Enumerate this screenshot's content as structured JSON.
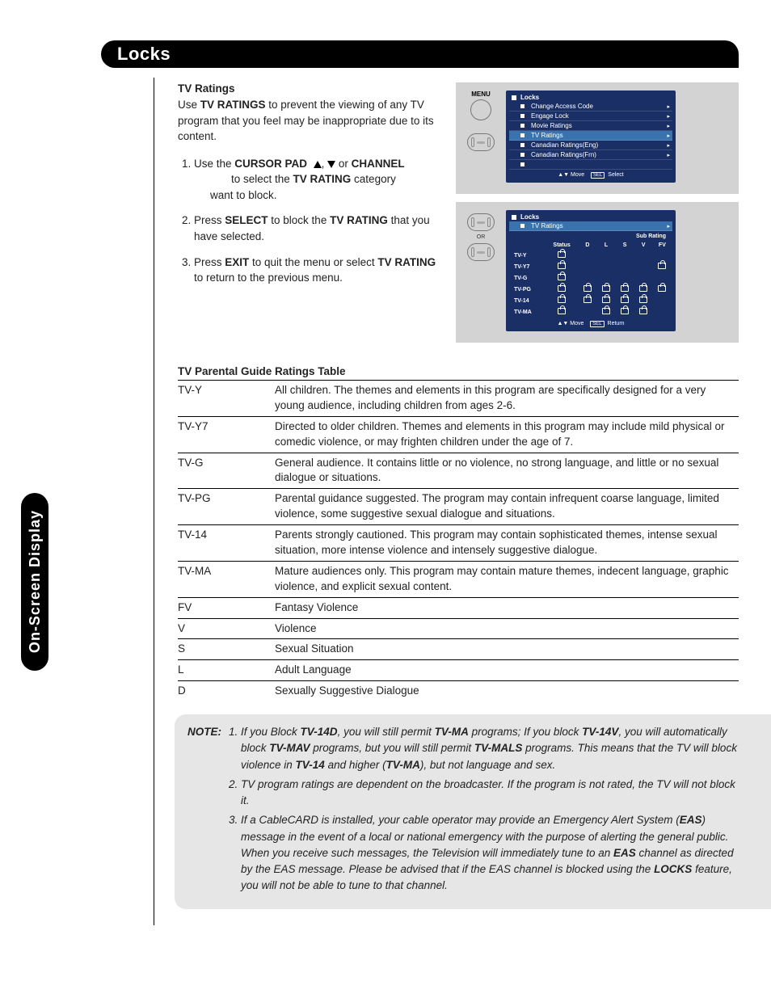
{
  "side_tab": "On-Screen Display",
  "header": "Locks",
  "sec1_title": "TV Ratings",
  "sec1_intro_a": "Use ",
  "sec1_intro_b": "TV RATINGS",
  "sec1_intro_c": " to prevent the viewing of any TV program that you feel may be inappropriate due to its content.",
  "step1_a": "Use the ",
  "step1_b": "CURSOR PAD",
  "step1_c": ", ",
  "step1_d": " or ",
  "step1_e": "CHANNEL",
  "step1_line2_a": " to select the ",
  "step1_line2_b": "TV RATING",
  "step1_line2_c": " category",
  "step1_line3": "want to block.",
  "step2_a": "Press ",
  "step2_b": "SELECT",
  "step2_c": " to block the ",
  "step2_d": "TV RATING",
  "step2_e": " that you have selected.",
  "step3_a": "Press ",
  "step3_b": "EXIT",
  "step3_c": " to quit the menu or select ",
  "step3_d": "TV RATING",
  "step3_e": " to return to the previous menu.",
  "panel1": {
    "menu_label": "MENU",
    "title": "Locks",
    "items": [
      "Change Access Code",
      "Engage Lock",
      "Movie Ratings",
      "TV Ratings",
      "Canadian Ratings(Eng)",
      "Canadian Ratings(Frn)"
    ],
    "foot_move": "Move",
    "foot_sel": "SEL",
    "foot_select": "Select"
  },
  "panel2": {
    "or": "OR",
    "title": "Locks",
    "sub": "TV Ratings",
    "subrating": "Sub Rating",
    "status": "Status",
    "cols": [
      "D",
      "L",
      "S",
      "V",
      "FV"
    ],
    "rows": [
      "TV-Y",
      "TV-Y7",
      "TV-G",
      "TV-PG",
      "TV-14",
      "TV-MA"
    ],
    "foot_move": "Move",
    "foot_sel": "SEL",
    "foot_return": "Return"
  },
  "table_title": "TV Parental Guide Ratings Table",
  "ratings": [
    {
      "code": "TV-Y",
      "desc": "All children. The themes and elements in this program are specifically designed for a very young audience, including children from ages 2-6."
    },
    {
      "code": "TV-Y7",
      "desc": "Directed to older children. Themes and elements in this program may include mild physical or comedic violence, or may frighten children under the age of 7."
    },
    {
      "code": "TV-G",
      "desc": "General audience. It contains little or no violence, no strong language, and little or no sexual dialogue or situations."
    },
    {
      "code": "TV-PG",
      "desc": "Parental guidance suggested. The program may contain infrequent coarse language, limited violence, some suggestive sexual dialogue and situations."
    },
    {
      "code": "TV-14",
      "desc": "Parents strongly cautioned. This program may contain sophisticated themes, intense sexual situation, more intense violence and intensely suggestive dialogue."
    },
    {
      "code": "TV-MA",
      "desc": "Mature audiences only. This program may contain mature themes, indecent language, graphic violence, and explicit sexual content."
    },
    {
      "code": "FV",
      "desc": "Fantasy Violence"
    },
    {
      "code": "V",
      "desc": "Violence"
    },
    {
      "code": "S",
      "desc": "Sexual Situation"
    },
    {
      "code": "L",
      "desc": "Adult Language"
    },
    {
      "code": "D",
      "desc": "Sexually Suggestive Dialogue"
    }
  ],
  "note_label": "NOTE:",
  "notes": {
    "n1": {
      "a": "If you Block ",
      "b": "TV-14D",
      "c": ", you will still permit ",
      "d": "TV-MA",
      "e": " programs; If you block ",
      "f": "TV-14V",
      "g": ", you will automatically block ",
      "h": "TV-MAV",
      "i": " programs, but you will still permit ",
      "j": "TV-MALS",
      "k": " programs. This means that the TV will block violence in ",
      "l": "TV-14",
      "m": " and higher (",
      "n": "TV-MA",
      "o": "), but not language and sex."
    },
    "n2": "TV program ratings are dependent on the broadcaster. If the program is not rated, the TV will not block it.",
    "n3": {
      "a": "If a CableCARD is installed, your cable operator may provide an Emergency Alert System (",
      "b": "EAS",
      "c": ") message in the event of a local or national emergency with the purpose of alerting the general public. When you receive such messages, the Television will immediately tune to an ",
      "d": "EAS",
      "e": " channel as directed by the EAS message. Please be advised that if the EAS channel is blocked using the ",
      "f": "LOCKS",
      "g": " feature, you will not be able to tune to that channel."
    }
  }
}
